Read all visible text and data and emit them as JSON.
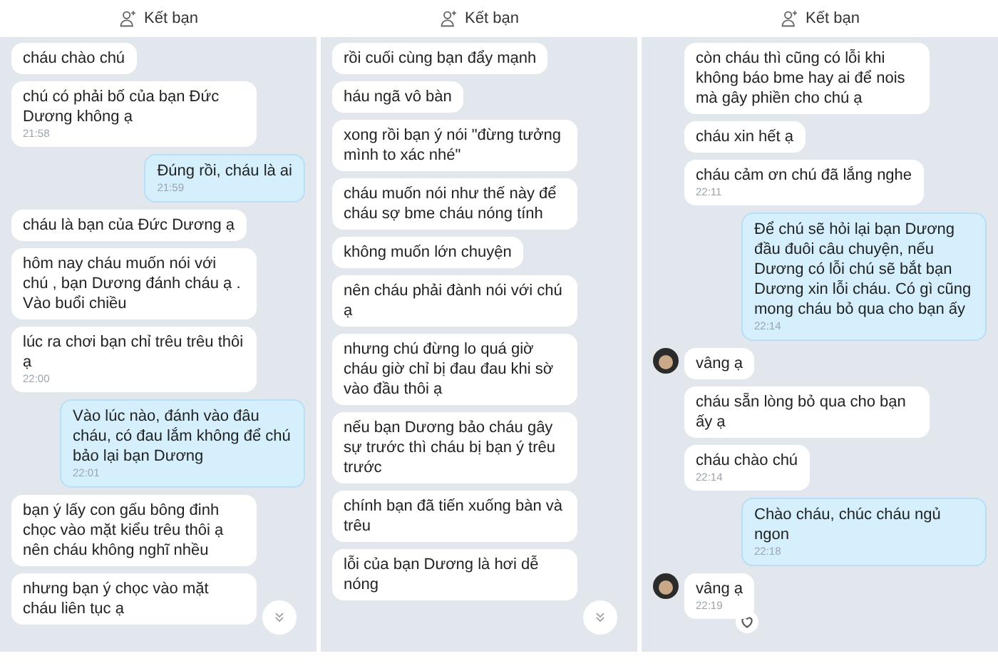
{
  "panels": [
    {
      "header": "Kết bạn",
      "scroll_button": true,
      "messages": [
        {
          "kind": "received",
          "text": "cháu chào chú"
        },
        {
          "kind": "received",
          "text": "chú có phải bố của bạn Đức Dương không ạ",
          "time": "21:58"
        },
        {
          "kind": "sent",
          "text": "Đúng rồi, cháu là ai",
          "time": "21:59"
        },
        {
          "kind": "received",
          "text": "cháu là bạn của Đức Dương ạ"
        },
        {
          "kind": "received",
          "text": "hôm nay cháu muốn nói với chú , bạn Dương đánh cháu ạ . Vào buổi chiều"
        },
        {
          "kind": "received",
          "text": "lúc ra chơi bạn chỉ trêu trêu thôi ạ",
          "time": "22:00"
        },
        {
          "kind": "sent",
          "text": "Vào lúc nào, đánh vào đâu cháu, có đau lắm không để chú bảo lại bạn Dương",
          "time": "22:01"
        },
        {
          "kind": "received",
          "text": "bạn ý lấy con gấu bông đinh chọc vào mặt kiểu trêu thôi ạ nên cháu không nghĩ nhều"
        },
        {
          "kind": "received",
          "text": "nhưng bạn ý chọc vào mặt cháu liên tục ạ"
        }
      ]
    },
    {
      "header": "Kết bạn",
      "scroll_button": true,
      "messages": [
        {
          "kind": "received",
          "text": "rồi cuối cùng bạn đẩy mạnh"
        },
        {
          "kind": "received",
          "text": "háu ngã vô bàn"
        },
        {
          "kind": "received",
          "text": "xong rồi bạn ý nói \"đừng tưởng mình to xác nhé\""
        },
        {
          "kind": "received",
          "text": "cháu muốn nói như thế này để cháu sợ bme cháu nóng tính"
        },
        {
          "kind": "received",
          "text": "không muốn lớn chuyện"
        },
        {
          "kind": "received",
          "text": "nên cháu phải đành nói với chú ạ"
        },
        {
          "kind": "received",
          "text": "nhưng chú đừng lo quá giờ cháu giờ chỉ bị đau đau khi sờ vào đầu thôi ạ"
        },
        {
          "kind": "received",
          "text": "nếu bạn Dương bảo cháu gây sự trước thì cháu bị bạn ý trêu trước"
        },
        {
          "kind": "received",
          "text": "chính bạn đã tiến xuống bàn và trêu"
        },
        {
          "kind": "received",
          "text": "lỗi của bạn Dương là hơi dễ nóng"
        }
      ]
    },
    {
      "header": "Kết bạn",
      "scroll_button": false,
      "messages": [
        {
          "kind": "received",
          "text": "còn cháu thì cũng có lỗi khi không báo bme hay ai để nois mà gây phiền cho chú ạ"
        },
        {
          "kind": "received",
          "text": "cháu xin hết ạ"
        },
        {
          "kind": "received",
          "text": "cháu cảm ơn chú đã lắng nghe",
          "time": "22:11"
        },
        {
          "kind": "sent",
          "text": "Để chú sẽ hỏi lại bạn Dương đầu đuôi câu chuyện, nếu Dương có lỗi chú sẽ bắt bạn Dương xin lỗi cháu. Có gì cũng mong cháu bỏ qua cho bạn ấy",
          "time": "22:14"
        },
        {
          "kind": "received",
          "avatar": true,
          "text": "vâng ạ"
        },
        {
          "kind": "received",
          "text": "cháu sẵn lòng bỏ qua cho bạn ấy ạ"
        },
        {
          "kind": "received",
          "text": "cháu chào chú",
          "time": "22:14"
        },
        {
          "kind": "sent",
          "text": "Chào cháu, chúc cháu ngủ ngon",
          "time": "22:18"
        },
        {
          "kind": "received",
          "avatar": true,
          "reaction_button": true,
          "text": "vâng ạ",
          "time": "22:19"
        }
      ]
    }
  ]
}
